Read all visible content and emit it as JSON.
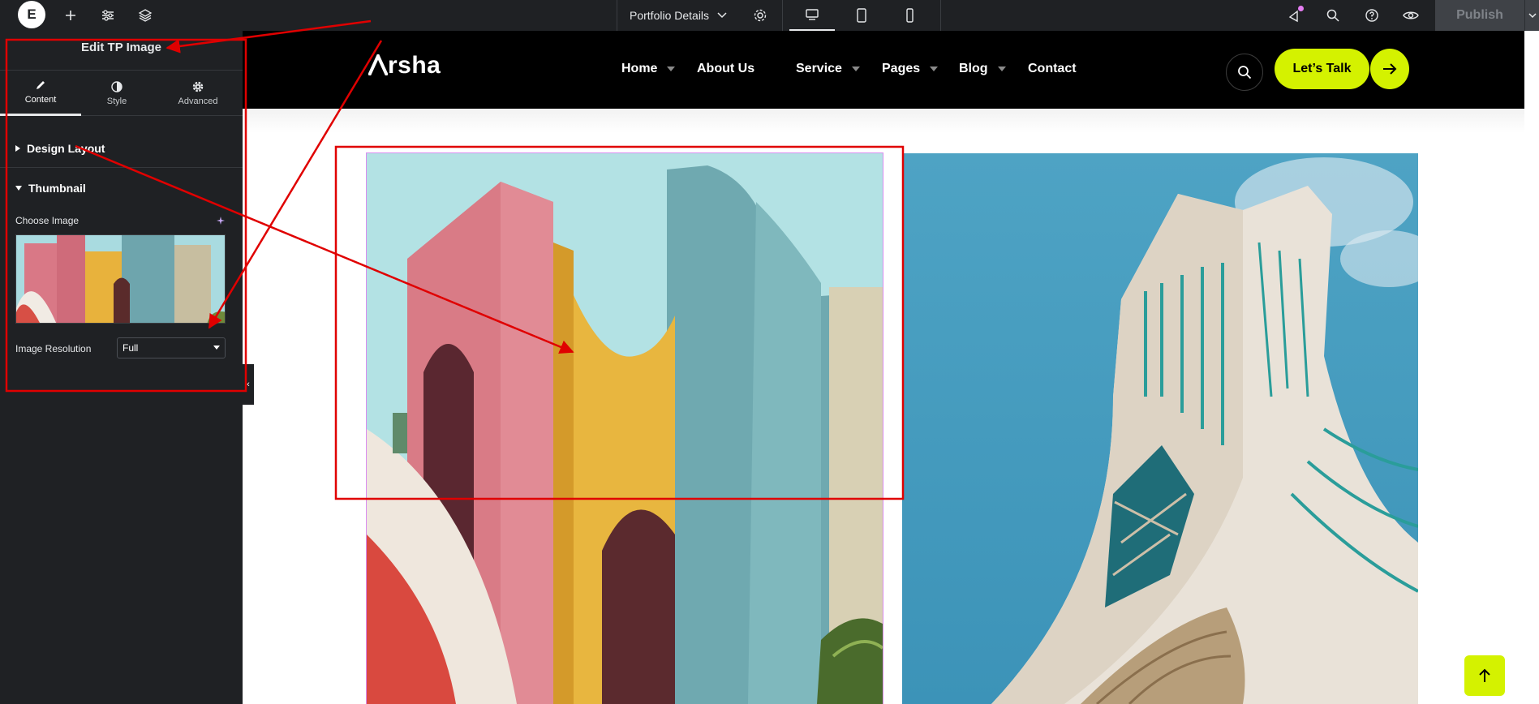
{
  "editor": {
    "logo_letter": "E",
    "document_title": "Portfolio Details",
    "publish_label": "Publish",
    "icons": [
      "elementor-logo-icon",
      "add-icon",
      "settings-sliders-icon",
      "layers-icon",
      "chevron-down-icon",
      "gear-icon",
      "desktop-icon",
      "tablet-icon",
      "mobile-icon",
      "whats-new-icon",
      "search-icon",
      "help-icon",
      "preview-eye-icon"
    ]
  },
  "panel": {
    "title": "Edit TP Image",
    "tabs": [
      {
        "label": "Content",
        "icon": "pencil-icon",
        "active": true
      },
      {
        "label": "Style",
        "icon": "half-circle-icon",
        "active": false
      },
      {
        "label": "Advanced",
        "icon": "gear-icon",
        "active": false
      }
    ],
    "sections": [
      {
        "label": "Design Layout",
        "expanded": false
      },
      {
        "label": "Thumbnail",
        "expanded": true
      }
    ],
    "choose_image_label": "Choose Image",
    "image_resolution_label": "Image Resolution",
    "image_resolution_value": "Full"
  },
  "site": {
    "brand": "Arsha",
    "brand_rest": "rsha",
    "nav": [
      {
        "label": "Home",
        "dropdown": true
      },
      {
        "label": "About Us",
        "dropdown": false
      },
      {
        "label": "Service",
        "dropdown": true
      },
      {
        "label": "Pages",
        "dropdown": true
      },
      {
        "label": "Blog",
        "dropdown": true
      },
      {
        "label": "Contact",
        "dropdown": false
      }
    ],
    "cta_label": "Let’s Talk",
    "accent_color": "#d4f200"
  },
  "colors": {
    "editor_bg": "#1f2124",
    "annotation_red": "#e00000",
    "selection_outline": "#d98cf0"
  }
}
